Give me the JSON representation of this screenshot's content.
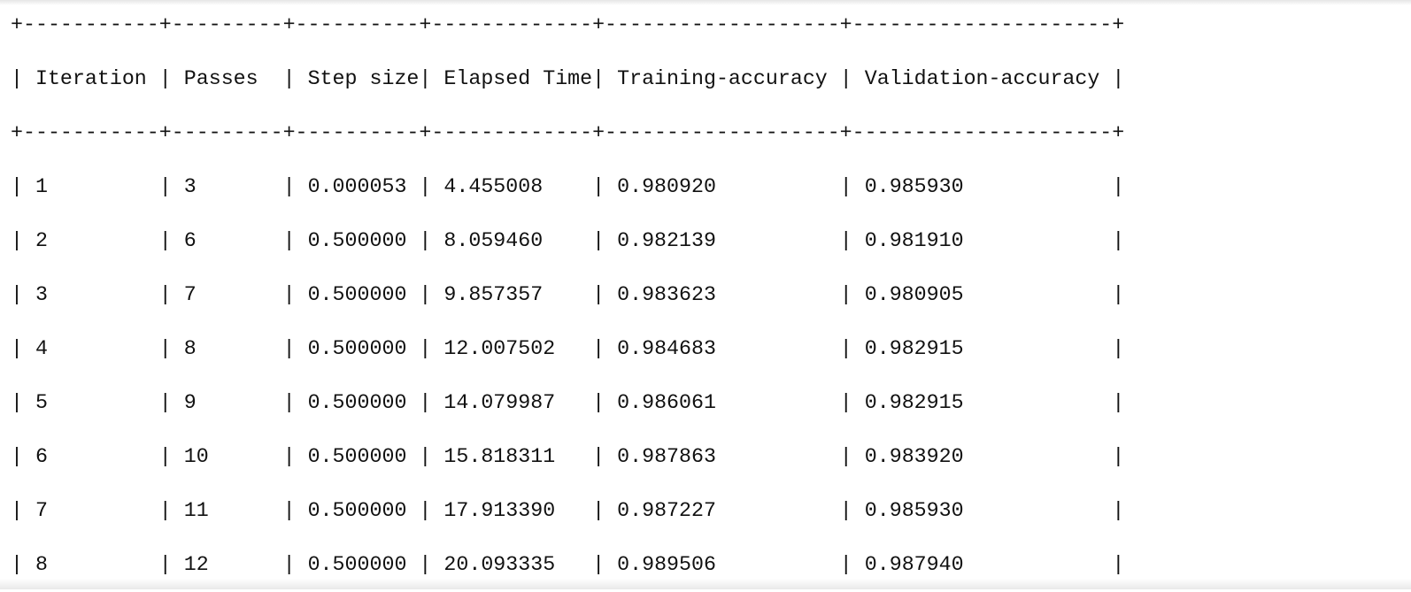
{
  "table": {
    "columns": [
      "Iteration",
      "Passes",
      "Step size",
      "Elapsed Time",
      "Training-accuracy",
      "Validation-accuracy"
    ],
    "widths": [
      11,
      9,
      10,
      13,
      19,
      21
    ],
    "rows": [
      [
        "1",
        "3",
        "0.000053",
        "4.455008",
        "0.980920",
        "0.985930"
      ],
      [
        "2",
        "6",
        "0.500000",
        "8.059460",
        "0.982139",
        "0.981910"
      ],
      [
        "3",
        "7",
        "0.500000",
        "9.857357",
        "0.983623",
        "0.980905"
      ],
      [
        "4",
        "8",
        "0.500000",
        "12.007502",
        "0.984683",
        "0.982915"
      ],
      [
        "5",
        "9",
        "0.500000",
        "14.079987",
        "0.986061",
        "0.982915"
      ],
      [
        "6",
        "10",
        "0.500000",
        "15.818311",
        "0.987863",
        "0.983920"
      ],
      [
        "7",
        "11",
        "0.500000",
        "17.913390",
        "0.987227",
        "0.985930"
      ],
      [
        "8",
        "12",
        "0.500000",
        "20.093335",
        "0.989506",
        "0.987940"
      ]
    ]
  }
}
